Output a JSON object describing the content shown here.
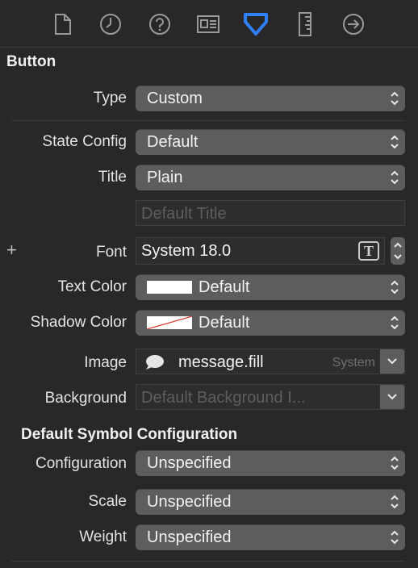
{
  "toolbar": {
    "icons": [
      "file-icon",
      "clock-icon",
      "help-icon",
      "identity-card-icon",
      "attributes-icon",
      "ruler-icon",
      "connections-icon"
    ],
    "selected": "attributes-icon",
    "accent": "#2f7ff6"
  },
  "button_section": {
    "title": "Button",
    "type": {
      "label": "Type",
      "value": "Custom"
    },
    "state_config": {
      "label": "State Config",
      "value": "Default"
    },
    "title_row": {
      "label": "Title",
      "value": "Plain"
    },
    "title_field": {
      "placeholder": "Default Title"
    },
    "font": {
      "label": "Font",
      "value": "System 18.0",
      "add_symbol": "+",
      "glyph": "T"
    },
    "text_color": {
      "label": "Text Color",
      "value": "Default",
      "swatch": "#ffffff"
    },
    "shadow_color": {
      "label": "Shadow Color",
      "value": "Default",
      "swatch": "none"
    },
    "image": {
      "label": "Image",
      "value": "message.fill",
      "tag": "System"
    },
    "background": {
      "label": "Background",
      "placeholder": "Default Background I..."
    }
  },
  "symbol_section": {
    "title": "Default Symbol Configuration",
    "configuration": {
      "label": "Configuration",
      "value": "Unspecified"
    },
    "scale": {
      "label": "Scale",
      "value": "Unspecified"
    },
    "weight": {
      "label": "Weight",
      "value": "Unspecified"
    }
  }
}
